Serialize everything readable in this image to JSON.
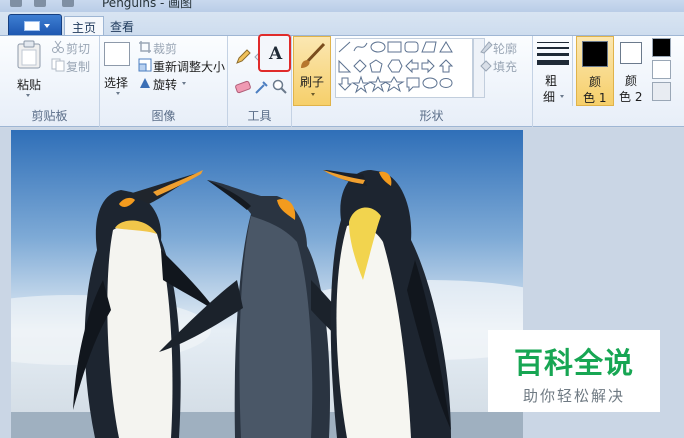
{
  "window": {
    "title": "Penguins - 画图"
  },
  "tabs": [
    {
      "label": "主页",
      "active": true
    },
    {
      "label": "查看",
      "active": false
    }
  ],
  "clipboard": {
    "paste_label": "粘贴",
    "cut_label": "剪切",
    "copy_label": "复制",
    "group_label": "剪贴板"
  },
  "image": {
    "select_label": "选择",
    "crop_label": "裁剪",
    "resize_label": "重新调整大小",
    "rotate_label": "旋转",
    "group_label": "图像"
  },
  "tools": {
    "group_label": "工具",
    "text_tool_glyph": "A",
    "highlight_color": "#e02b2b"
  },
  "brushes": {
    "label": "刷子"
  },
  "shapes": {
    "group_label": "形状",
    "outline_label": "轮廓",
    "fill_label": "填充"
  },
  "size": {
    "label_line1": "粗",
    "label_line2": "细"
  },
  "colors": {
    "color1_line1": "颜",
    "color1_line2": "色 1",
    "color2_line1": "颜",
    "color2_line2": "色 2",
    "color1_value": "#000000",
    "color2_value": "#ffffff",
    "palette": [
      "#000000",
      "#ffffff",
      "#e8ecf2",
      "#f2f4f8",
      "#eef1f6",
      "#dde3eb"
    ]
  },
  "watermark": {
    "title": "百科全说",
    "subtitle": "助你轻松解决",
    "title_color": "#17a653"
  }
}
